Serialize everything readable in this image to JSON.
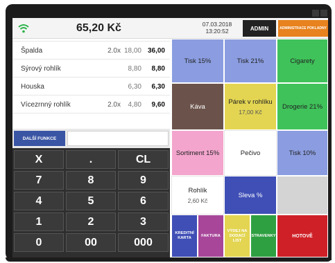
{
  "status": {
    "total": "65,20 Kč",
    "date": "07.03.2018",
    "time": "13:20:52",
    "admin_label": "ADMIN",
    "admin_register_label": "ADMINISTRACE POKLADNY"
  },
  "items": [
    {
      "name": "Špalda",
      "qty": "2.0x",
      "price": "18,00",
      "sum": "36,00"
    },
    {
      "name": "Sýrový rohlík",
      "qty": "",
      "price": "8,80",
      "sum": "8,80"
    },
    {
      "name": "Houska",
      "qty": "",
      "price": "6,30",
      "sum": "6,30"
    },
    {
      "name": "Vícezrnný rohlík",
      "qty": "2.0x",
      "price": "4,80",
      "sum": "9,60"
    }
  ],
  "functions": {
    "more_label": "DALŠÍ FUNKCE",
    "entry_value": ""
  },
  "keypad": [
    "X",
    ".",
    "CL",
    "7",
    "8",
    "9",
    "4",
    "5",
    "6",
    "1",
    "2",
    "3",
    "0",
    "00",
    "000"
  ],
  "tiles": {
    "tisk15": {
      "label": "Tisk 15%"
    },
    "tisk21": {
      "label": "Tisk 21%"
    },
    "cigarety": {
      "label": "Cigarety"
    },
    "kava": {
      "label": "Káva"
    },
    "parek": {
      "label": "Párek v rohlíku",
      "price": "17,00 Kč"
    },
    "drogerie": {
      "label": "Drogerie 21%"
    },
    "sortiment": {
      "label": "Sortiment 15%"
    },
    "pecivo": {
      "label": "Pečivo"
    },
    "tisk10": {
      "label": "Tisk 10%"
    },
    "rohlik": {
      "label": "Rohlík",
      "price": "2,60 Kč"
    },
    "sleva": {
      "label": "Sleva %"
    },
    "kreditni": {
      "label": "KREDITNÍ KARTA"
    },
    "faktura": {
      "label": "FAKTURA"
    },
    "vydej": {
      "label": "VÝDEJ NA DODACÍ LIST"
    },
    "stravenky": {
      "label": "STRAVENKY"
    },
    "hotove": {
      "label": "HOTOVĚ"
    }
  },
  "colors": {
    "blue_tile": "#8b9de0",
    "brown_tile": "#6b534b",
    "yellow_tile": "#e3d552",
    "green_tile": "#3fc25a",
    "pink_tile": "#f3a5cd",
    "navy_tile": "#3f4fb6",
    "grey_tile": "#d4d4d4",
    "red_tile": "#cf2027",
    "purple_tile": "#a8479a",
    "dark_green_tile": "#2fa042",
    "orange_admin": "#e8821e"
  }
}
